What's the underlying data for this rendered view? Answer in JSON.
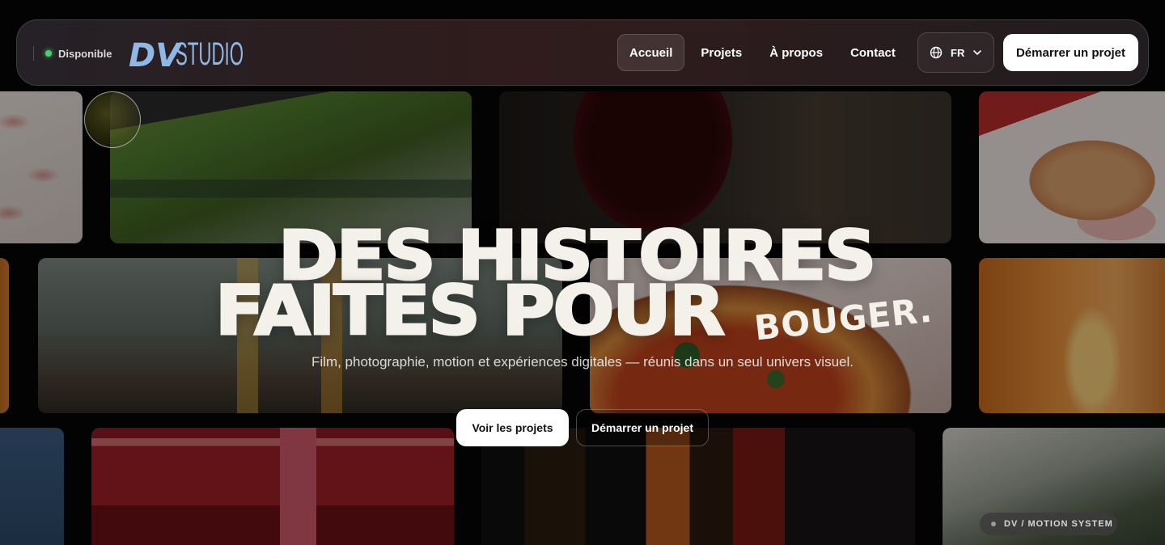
{
  "status": {
    "label": "Disponible"
  },
  "brand": {
    "mark": "DV",
    "word": "STUDIO"
  },
  "nav": {
    "links": [
      {
        "label": "Accueil",
        "active": true
      },
      {
        "label": "Projets",
        "active": false
      },
      {
        "label": "À propos",
        "active": false
      },
      {
        "label": "Contact",
        "active": false
      }
    ],
    "language": "FR",
    "cta_label": "Démarrer un projet"
  },
  "hero": {
    "title_line1": "DES HISTOIRES",
    "title_line2": "FAITES POUR",
    "title_script": "BOUGER.",
    "subtitle": "Film, photographie, motion et expériences digitales — réunis dans un seul univers visuel.",
    "primary_label": "Voir les projets",
    "secondary_label": "Démarrer un projet"
  },
  "chip": {
    "label": "DV / MOTION SYSTEM"
  },
  "icons": {
    "language": "globe-icon",
    "language_toggle": "chevron-down-icon",
    "status": "status-dot-icon"
  },
  "colors": {
    "accent_status": "#4ccf69",
    "button_bg": "#ffffff",
    "hero_text": "#f4f0ea"
  }
}
